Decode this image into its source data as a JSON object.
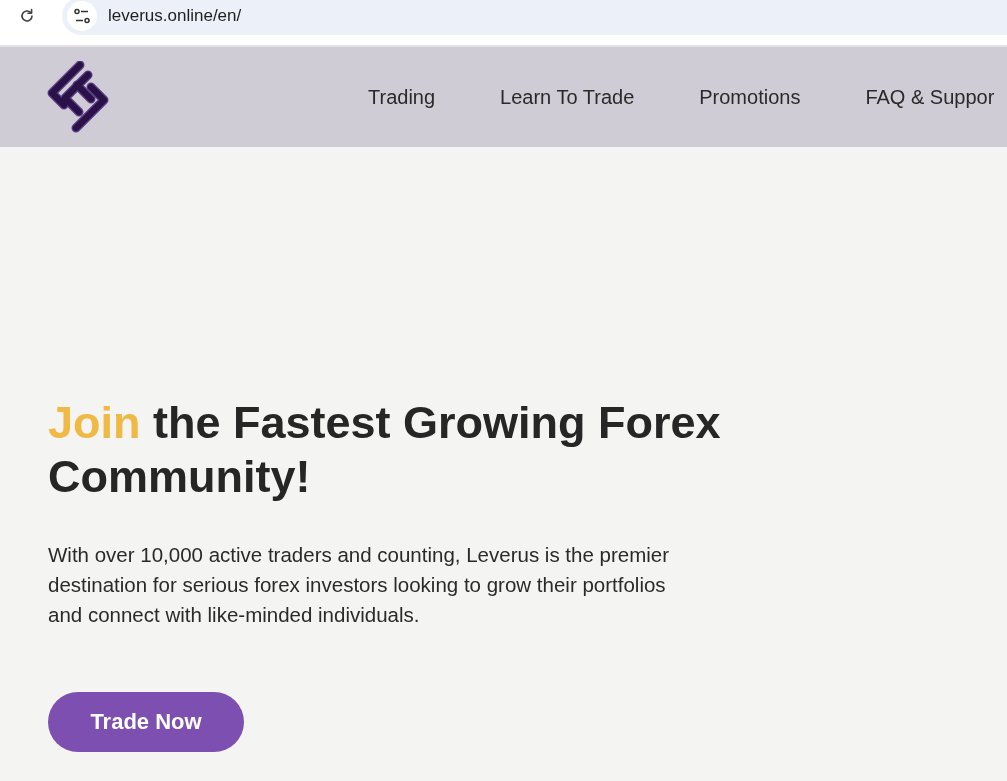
{
  "browser": {
    "url": "leverus.online/en/"
  },
  "header": {
    "nav": [
      "Trading",
      "Learn To Trade",
      "Promotions",
      "FAQ & Suppor"
    ]
  },
  "hero": {
    "headline": {
      "highlight": "Join",
      "text": "the Fastest Growing Forex Community!"
    },
    "paragraph": "With over 10,000 active traders and counting, Leverus is the premier destination for serious forex investors looking to grow their portfolios and connect with like-minded individuals.",
    "button": "Trade Now"
  }
}
